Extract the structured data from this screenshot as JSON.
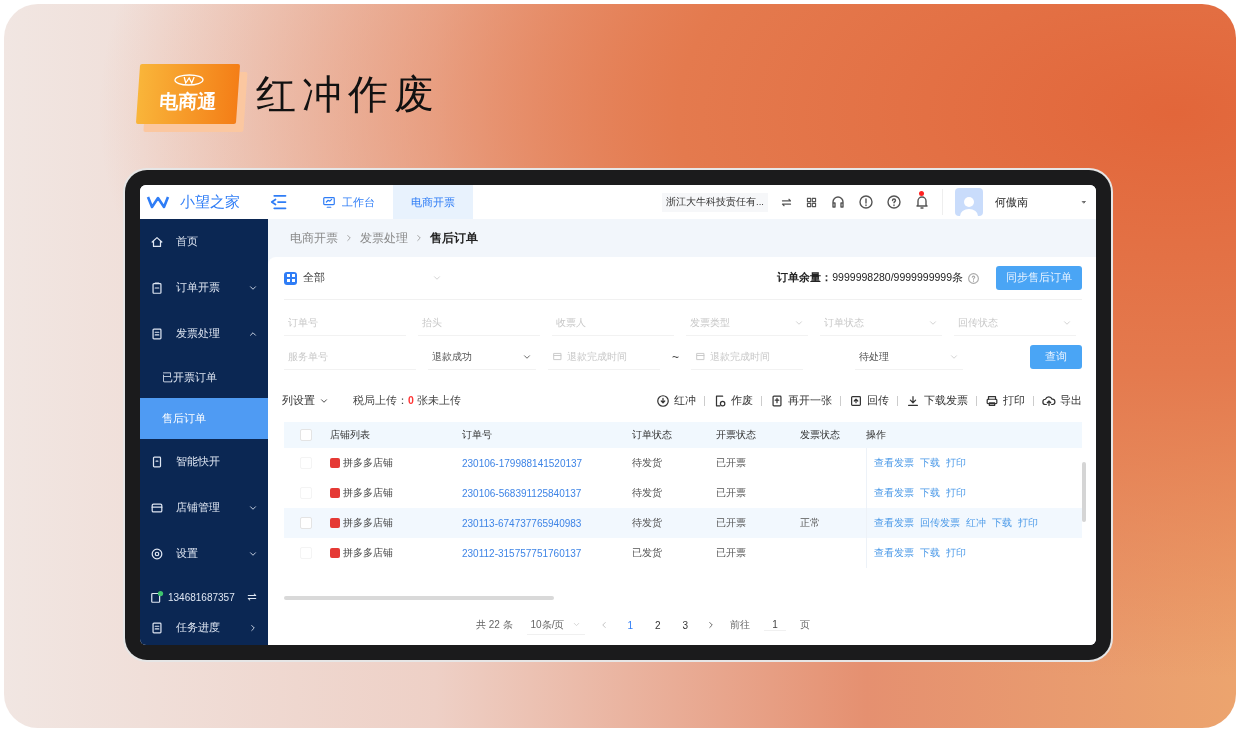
{
  "brand": {
    "badge": "电商通",
    "title": "红冲作废"
  },
  "app": {
    "name": "小望之家",
    "tabs": [
      {
        "label": "工作台",
        "selected": false
      },
      {
        "label": "电商开票",
        "selected": true
      }
    ],
    "company": "浙江大牛科技责任有...",
    "user": "何傲南",
    "has_unread": true
  },
  "sidebar": {
    "items": [
      {
        "label": "首页",
        "selected": false
      },
      {
        "label": "订单开票",
        "expanded": false,
        "selected": false
      },
      {
        "label": "发票处理",
        "expanded": true,
        "selected": false,
        "children": [
          {
            "label": "已开票订单",
            "selected": false
          },
          {
            "label": "售后订单",
            "selected": true
          }
        ]
      },
      {
        "label": "智能快开",
        "selected": false
      },
      {
        "label": "店铺管理",
        "expanded": false,
        "selected": false
      },
      {
        "label": "设置",
        "expanded": false,
        "selected": false
      }
    ],
    "account": "134681687357",
    "tasks": "任务进度"
  },
  "breadcrumb": [
    "电商开票",
    "发票处理",
    "售后订单"
  ],
  "filter": {
    "shop": "全部",
    "quota_label": "订单余量：",
    "quota_value": "9999998280/9999999999条",
    "sync_button": "同步售后订单",
    "fields": [
      {
        "kind": "input",
        "placeholder": "订单号"
      },
      {
        "kind": "input",
        "placeholder": "抬头"
      },
      {
        "kind": "input",
        "placeholder": "收票人"
      },
      {
        "kind": "select",
        "placeholder": "发票类型"
      },
      {
        "kind": "select",
        "placeholder": "订单状态"
      },
      {
        "kind": "select",
        "placeholder": "回传状态"
      }
    ],
    "service_no": {
      "placeholder": "服务单号"
    },
    "refund_status": {
      "value": "退款成功"
    },
    "date_from": {
      "placeholder": "退款完成时间"
    },
    "range_separator": "~",
    "date_to": {
      "placeholder": "退款完成时间"
    },
    "process_status": {
      "value": "待处理"
    },
    "query_button": "查询"
  },
  "toolbar": {
    "columns": "列设置",
    "upload_label": "税局上传：",
    "upload_count": "0",
    "upload_suffix": "张未上传",
    "actions": [
      {
        "label": "红冲"
      },
      {
        "label": "作废"
      },
      {
        "label": "再开一张"
      },
      {
        "label": "回传"
      },
      {
        "label": "下载发票"
      },
      {
        "label": "打印"
      },
      {
        "label": "导出"
      }
    ]
  },
  "table": {
    "all_checked": false,
    "columns": [
      "店铺列表",
      "订单号",
      "订单状态",
      "开票状态",
      "发票状态",
      "操作"
    ],
    "rows": [
      {
        "shop": "拼多多店铺",
        "order": "230106-179988141520137",
        "order_status": "待发货",
        "invoice_status": "已开票",
        "receipt_status": "",
        "highlighted": false,
        "checked": false,
        "actions": [
          "查看发票",
          "下载",
          "打印"
        ]
      },
      {
        "shop": "拼多多店铺",
        "order": "230106-568391125840137",
        "order_status": "待发货",
        "invoice_status": "已开票",
        "receipt_status": "",
        "highlighted": false,
        "checked": false,
        "actions": [
          "查看发票",
          "下载",
          "打印"
        ]
      },
      {
        "shop": "拼多多店铺",
        "order": "230113-674737765940983",
        "order_status": "待发货",
        "invoice_status": "已开票",
        "receipt_status": "正常",
        "highlighted": true,
        "checked": false,
        "actions": [
          "查看发票",
          "回传发票",
          "红冲",
          "下载",
          "打印"
        ]
      },
      {
        "shop": "拼多多店铺",
        "order": "230112-315757751760137",
        "order_status": "已发货",
        "invoice_status": "已开票",
        "receipt_status": "",
        "highlighted": false,
        "checked": false,
        "actions": [
          "查看发票",
          "下载",
          "打印"
        ]
      }
    ]
  },
  "pagination": {
    "total": "共 22 条",
    "page_size": "10条/页",
    "pages": [
      {
        "label": "1",
        "selected": true
      },
      {
        "label": "2",
        "selected": false
      },
      {
        "label": "3",
        "selected": false
      }
    ],
    "goto_label": "前往",
    "goto_value": "1",
    "goto_unit": "页"
  }
}
